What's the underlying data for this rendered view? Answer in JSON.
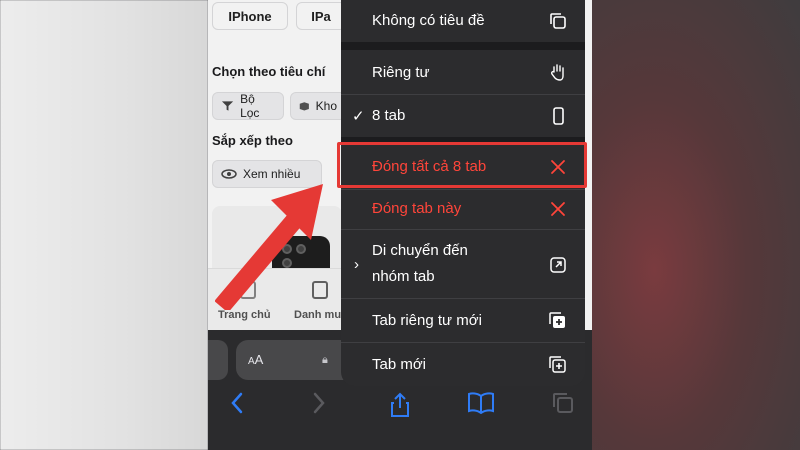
{
  "page": {
    "device_filters": [
      "IPhone",
      "IPa"
    ],
    "criteria_title": "Chọn theo tiêu chí",
    "criteria_chips": [
      "Bộ Lọc",
      "Kho"
    ],
    "sort_title": "Sắp xếp theo",
    "sort_chip": "Xem nhiều",
    "bottom_tabs": [
      "Trang chủ",
      "Danh mu"
    ]
  },
  "safari": {
    "address_text_size": "AA",
    "address_partial": "c"
  },
  "menu": {
    "items": [
      {
        "label": "Không có tiêu đề",
        "icon": "copy-icon"
      },
      {
        "label": "Riêng tư",
        "icon": "hand-icon"
      },
      {
        "label": "8 tab",
        "icon": "phone-icon",
        "checked": true
      },
      {
        "label": "Đóng tất cả 8 tab",
        "icon": "close-icon",
        "destructive": true
      },
      {
        "label": "Đóng tab này",
        "icon": "close-icon",
        "destructive": true
      },
      {
        "label": "Di chuyển đến",
        "label2": "nhóm tab",
        "icon": "move-icon"
      },
      {
        "label": "Tab riêng tư mới",
        "icon": "new-private-tab-icon"
      },
      {
        "label": "Tab mới",
        "icon": "new-tab-icon"
      }
    ]
  },
  "colors": {
    "destructive": "#ff453a",
    "highlight": "#e53935",
    "accent": "#2f7cf6"
  }
}
